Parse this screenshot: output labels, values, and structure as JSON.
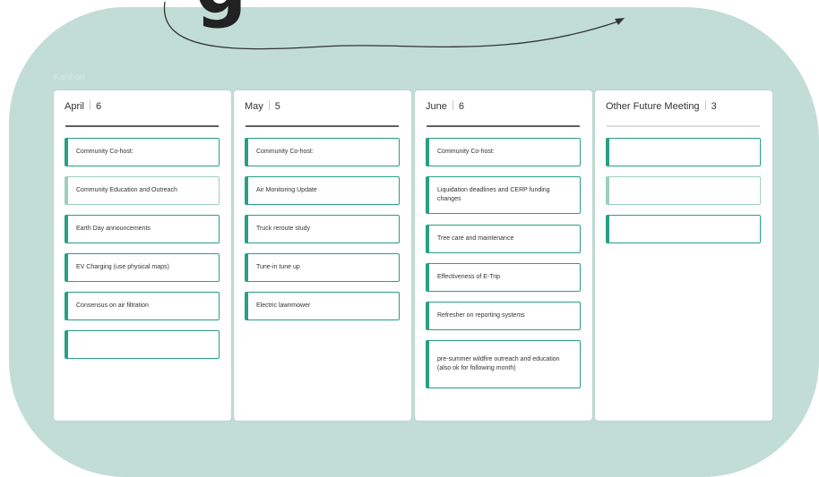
{
  "board": {
    "label": "Kanban",
    "accent_color": "#27a083",
    "background_color": "#c2ddd5"
  },
  "columns": [
    {
      "title": "April",
      "count": "6",
      "cards": [
        {
          "text": "Community Co-host:"
        },
        {
          "text": "Community Education and Outreach"
        },
        {
          "text": "Earth Day announcements"
        },
        {
          "text": "EV Charging (use physical maps)"
        },
        {
          "text": "Consensus on air filtration"
        },
        {
          "text": ""
        }
      ]
    },
    {
      "title": "May",
      "count": "5",
      "cards": [
        {
          "text": "Community Co-host:"
        },
        {
          "text": "Air Monitoring Update"
        },
        {
          "text": "Truck reroute study"
        },
        {
          "text": "Tune-in tune up"
        },
        {
          "text": "Electric lawnmower"
        }
      ]
    },
    {
      "title": "June",
      "count": "6",
      "cards": [
        {
          "text": "Community Co-host:"
        },
        {
          "text": "Liquidation deadlines and CERP funding changes"
        },
        {
          "text": "Tree care and maintenance"
        },
        {
          "text": "Effectiveness of E-Trip"
        },
        {
          "text": "Refresher on reporting systems"
        },
        {
          "text": "pre-summer wildfire outreach and education (also ok for following month)"
        }
      ]
    },
    {
      "title": "Other Future Meeting",
      "count": "3",
      "cards": [
        {
          "text": ""
        },
        {
          "text": ""
        },
        {
          "text": ""
        }
      ]
    }
  ]
}
